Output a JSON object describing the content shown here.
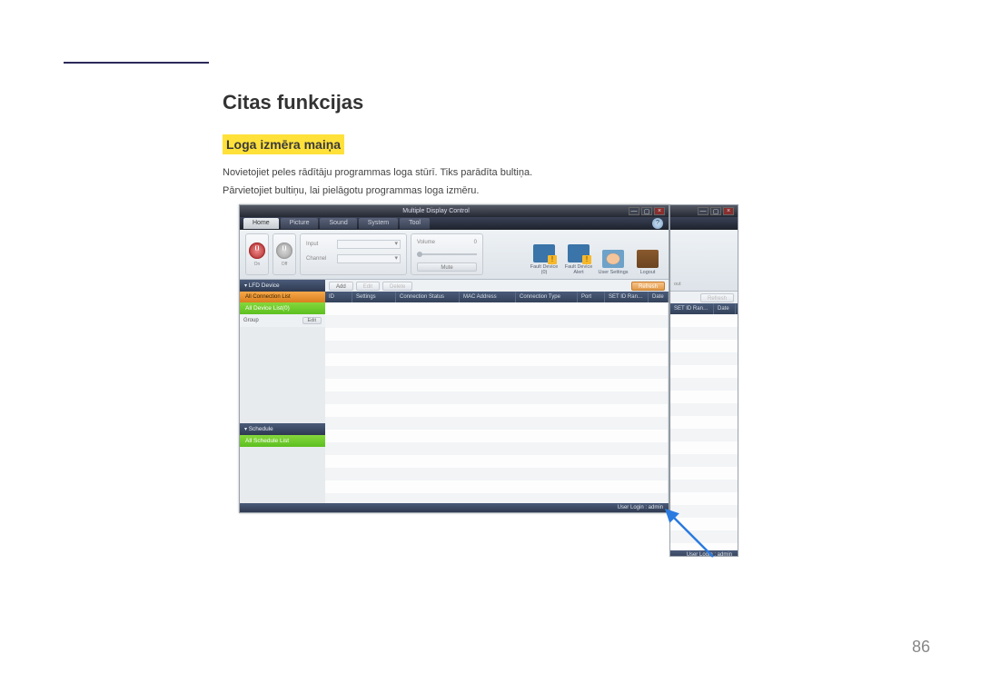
{
  "page": {
    "heading": "Citas funkcijas",
    "subheading": "Loga izmēra maiņa",
    "para1": "Novietojiet peles rādītāju programmas loga stūrī. Tiks parādīta bultiņa.",
    "para2": "Pārvietojiet bultiņu, lai pielāgotu programmas loga izmēru.",
    "pagenum": "86"
  },
  "app": {
    "title": "Multiple Display Control",
    "tabs": {
      "home": "Home",
      "picture": "Picture",
      "sound": "Sound",
      "system": "System",
      "tool": "Tool"
    },
    "help": "?",
    "ribbon": {
      "on": "On",
      "off": "Off",
      "input": "Input",
      "channel": "Channel",
      "volume": "Volume",
      "volval": "0",
      "mute": "Mute",
      "fault_device": "Fault Device\n(0)",
      "fault_alert": "Fault Device\nAlert",
      "user_settings": "User Settings",
      "logout": "Logout",
      "back_out": "out"
    },
    "sidebar": {
      "lfd": "LFD Device",
      "all_conn": "All Connection List",
      "all_dev": "All Device List(0)",
      "group": "Group",
      "edit": "Edit",
      "schedule": "Schedule",
      "all_sched": "All Schedule List"
    },
    "toolbar": {
      "add": "Add",
      "edit": "Edit",
      "delete": "Delete",
      "refresh": "Refresh"
    },
    "grid_headers": {
      "id": "ID",
      "settings": "Settings",
      "conn_status": "Connection Status",
      "mac": "MAC Address",
      "conn_type": "Connection Type",
      "port": "Port",
      "setid": "SET ID Ran…",
      "date": "Date"
    },
    "status": "User Login : admin"
  }
}
